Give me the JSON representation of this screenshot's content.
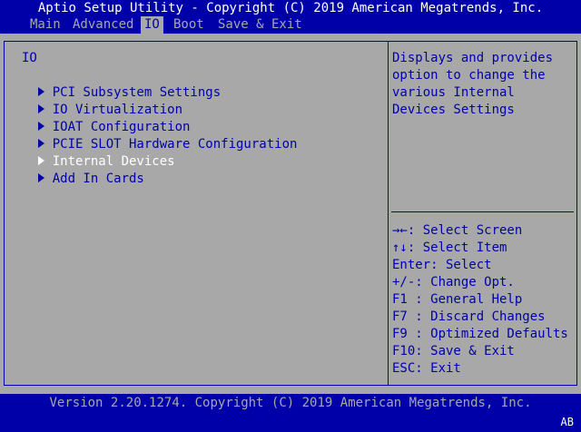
{
  "header": {
    "title": "Aptio Setup Utility - Copyright (C) 2019 American Megatrends, Inc."
  },
  "menu": {
    "tabs": [
      {
        "label": "Main"
      },
      {
        "label": "Advanced"
      },
      {
        "label": "IO",
        "active": true
      },
      {
        "label": "Boot"
      },
      {
        "label": "Save & Exit"
      }
    ]
  },
  "main": {
    "section_title": "IO",
    "items": [
      {
        "label": "PCI Subsystem Settings"
      },
      {
        "label": "IO Virtualization"
      },
      {
        "label": "IOAT Configuration"
      },
      {
        "label": "PCIE SLOT Hardware Configuration"
      },
      {
        "label": "Internal Devices",
        "selected": true
      },
      {
        "label": "Add In Cards"
      }
    ]
  },
  "help": {
    "description_lines": [
      "Displays and provides",
      "option to change the",
      "various Internal",
      "Devices Settings"
    ],
    "keys": [
      "→←: Select Screen",
      "↑↓: Select Item",
      "Enter: Select",
      "+/-: Change Opt.",
      "F1 : General Help",
      "F7 : Discard Changes",
      "F9 : Optimized Defaults",
      "F10: Save & Exit",
      "ESC: Exit"
    ]
  },
  "footer": {
    "version": "Version 2.20.1274. Copyright (C) 2019 American Megatrends, Inc."
  },
  "corner_badge": "AB",
  "colors": {
    "background": "#0000a8",
    "panel": "#a8a8a8",
    "text_on_panel": "#0000a8",
    "highlight": "#ffffff"
  }
}
